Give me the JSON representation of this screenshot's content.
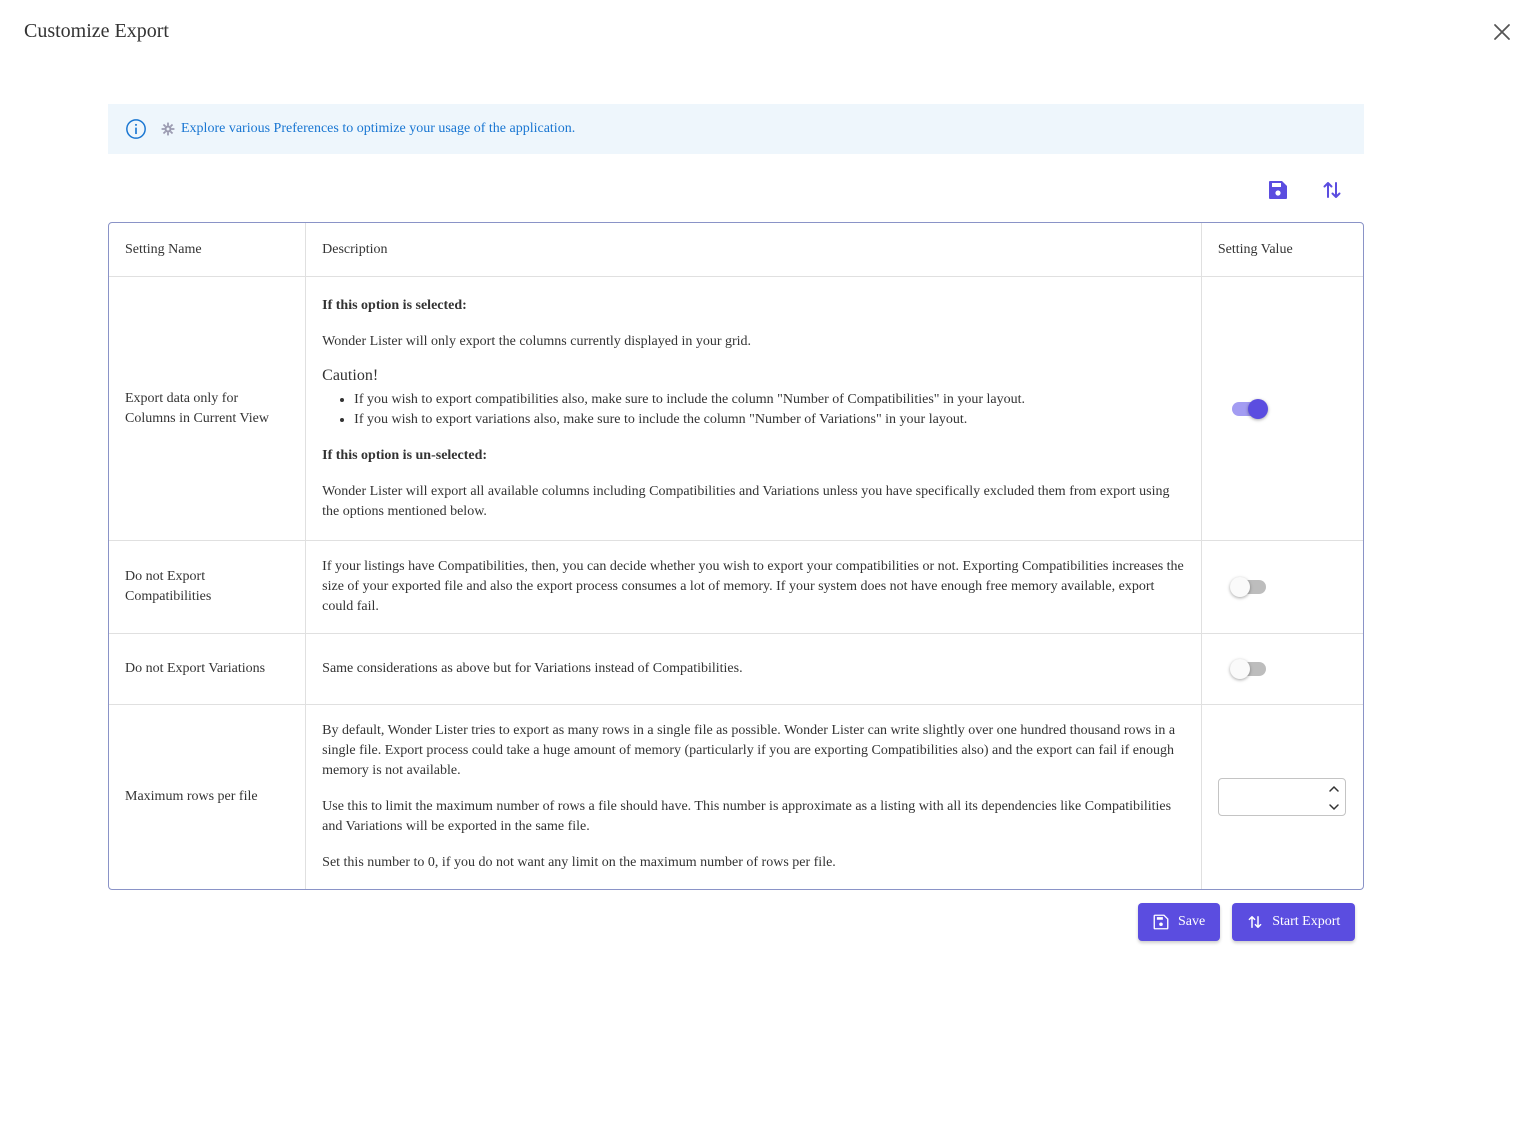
{
  "dialog": {
    "title": "Customize Export",
    "close_icon": "close-icon"
  },
  "banner": {
    "info_icon": "info-icon",
    "gear_icon": "gear-icon",
    "text": "Explore various Preferences to optimize your usage of the application."
  },
  "toolbar": {
    "save_icon": "save-icon",
    "export_icon": "sort-arrows-icon"
  },
  "table": {
    "headers": {
      "name": "Setting Name",
      "description": "Description",
      "value": "Setting Value"
    },
    "rows": [
      {
        "name": "Export data only for Columns in Current View",
        "desc": {
          "selected_heading": "If this option is selected:",
          "selected_text": "Wonder Lister will only export the columns currently displayed in your grid.",
          "caution": "Caution!",
          "bullets": [
            "If you wish to export compatibilities also, make sure to include the column \"Number of Compatibilities\" in your layout.",
            "If you wish to export variations also, make sure to include the column \"Number of Variations\" in your layout."
          ],
          "unselected_heading": "If this option is un-selected:",
          "unselected_text": "Wonder Lister will export all available columns including Compatibilities and Variations unless you have specifically excluded them from export using the options mentioned below."
        },
        "value": true
      },
      {
        "name": "Do not Export Compatibilities",
        "desc": "If your listings have Compatibilities, then, you can decide whether you wish to export your compatibilities or not. Exporting Compatibilities increases the size of your exported file and also the export process consumes a lot of memory. If your system does not have enough free memory available, export could fail.",
        "value": false
      },
      {
        "name": "Do not Export Variations",
        "desc": "Same considerations as above but for Variations instead of Compatibilities.",
        "value": false
      },
      {
        "name": "Maximum rows per file",
        "desc": [
          "By default, Wonder Lister tries to export as many rows in a single file as possible. Wonder Lister can write slightly over one hundred thousand rows in a single file. Export process could take a huge amount of memory (particularly if you are exporting Compatibilities also) and the export can fail if enough memory is not available.",
          "Use this to limit the maximum number of rows a file should have. This number is approximate as a listing with all its dependencies like Compatibilities and Variations will be exported in the same file.",
          "Set this number to 0, if you do not want any limit on the maximum number of rows per file."
        ],
        "value": ""
      }
    ]
  },
  "actions": {
    "save_label": "Save",
    "export_label": "Start Export"
  },
  "colors": {
    "accent": "#5b4de0",
    "banner_bg": "#eef6fc",
    "banner_text": "#1976d2"
  }
}
